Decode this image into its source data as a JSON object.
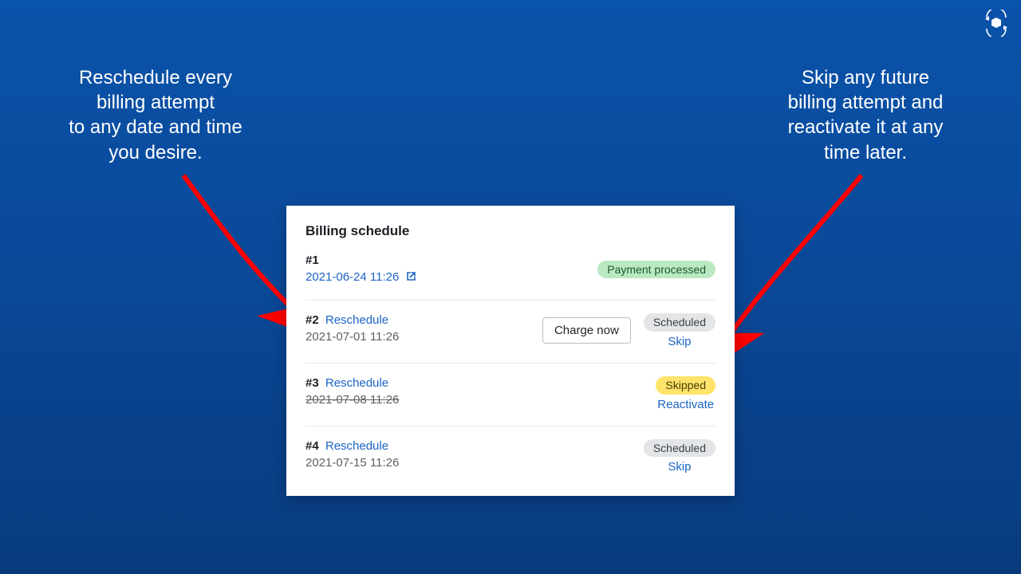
{
  "captions": {
    "left": "Reschedule every\nbilling attempt\nto any date and time\nyou desire.",
    "right": "Skip any future\nbilling attempt and\nreactivate it at any\ntime later."
  },
  "card": {
    "title": "Billing schedule",
    "reschedule_label": "Reschedule",
    "charge_now_label": "Charge now",
    "skip_label": "Skip",
    "reactivate_label": "Reactivate",
    "status": {
      "processed": "Payment processed",
      "scheduled": "Scheduled",
      "skipped": "Skipped"
    },
    "rows": [
      {
        "id": "#1",
        "date": "2021-06-24 11:26"
      },
      {
        "id": "#2",
        "date": "2021-07-01 11:26"
      },
      {
        "id": "#3",
        "date": "2021-07-08 11:26"
      },
      {
        "id": "#4",
        "date": "2021-07-15 11:26"
      }
    ]
  }
}
